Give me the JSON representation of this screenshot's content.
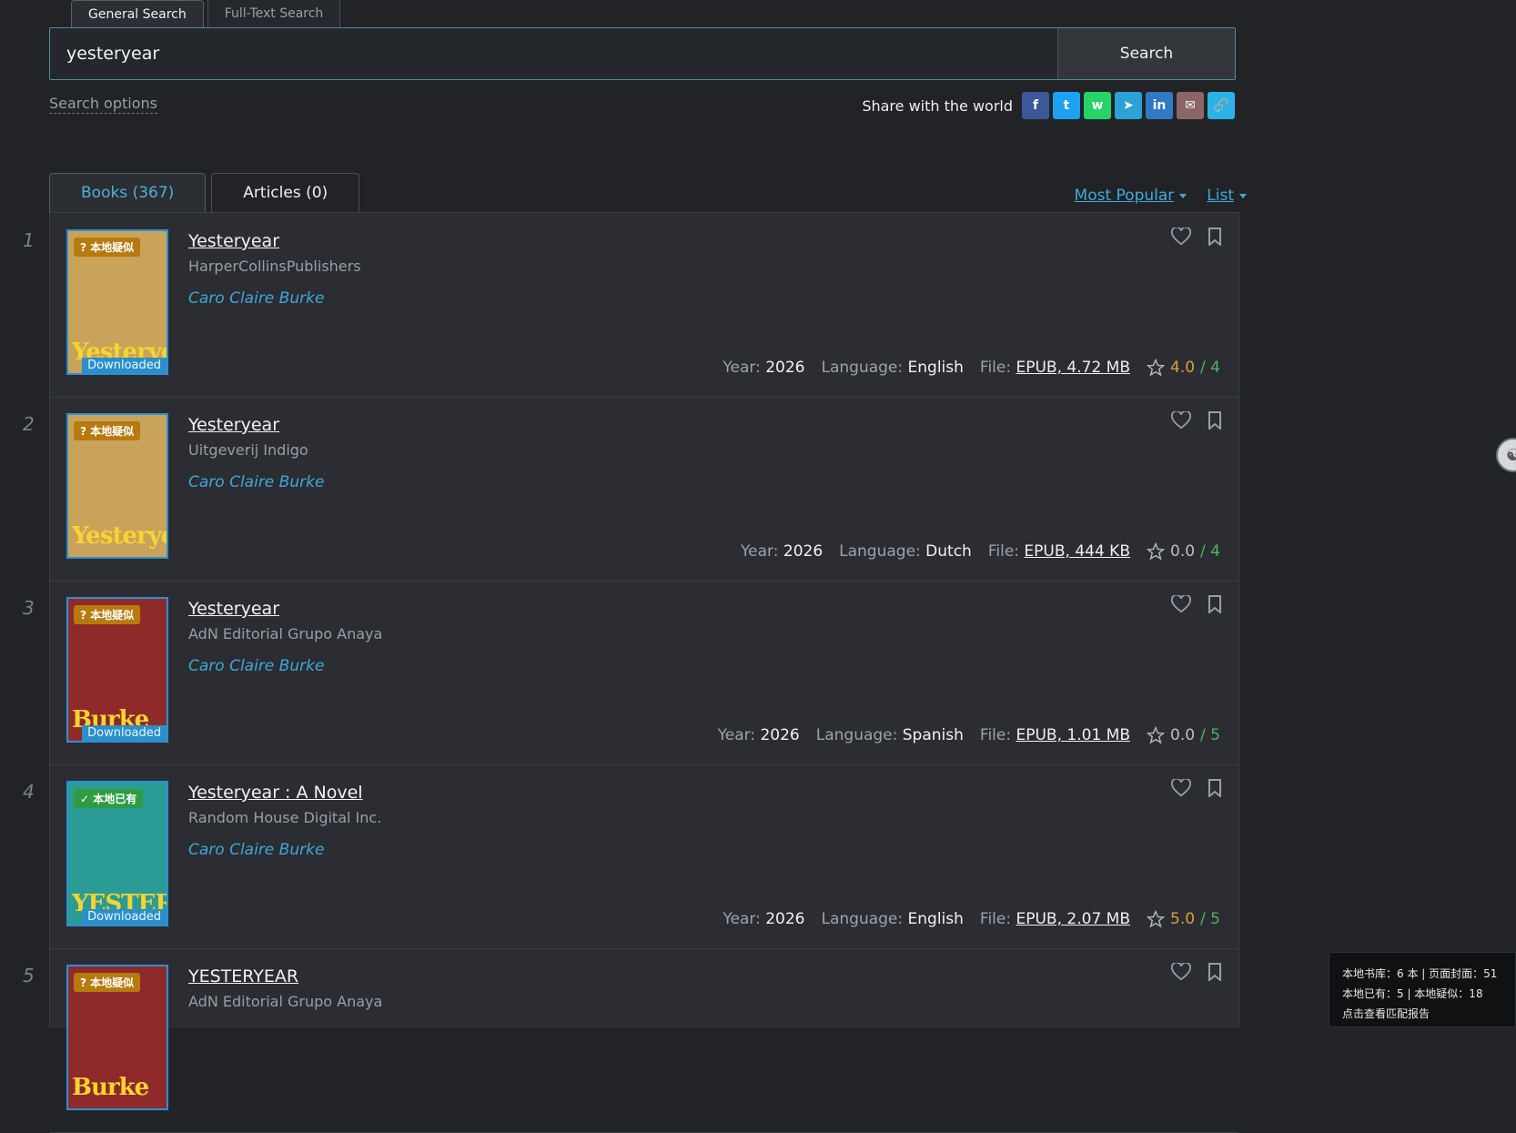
{
  "top_tabs": [
    {
      "label": "General Search",
      "active": true
    },
    {
      "label": "Full-Text Search",
      "active": false
    }
  ],
  "search": {
    "value": "yesteryear",
    "button_label": "Search"
  },
  "search_options_label": "Search options",
  "share": {
    "label": "Share with the world",
    "buttons": [
      {
        "icon": "facebook-icon",
        "glyph": "f",
        "color": "#3b5998"
      },
      {
        "icon": "twitter-icon",
        "glyph": "t",
        "color": "#1da1f2"
      },
      {
        "icon": "whatsapp-icon",
        "glyph": "w",
        "color": "#25d366"
      },
      {
        "icon": "telegram-icon",
        "glyph": "➤",
        "color": "#2aa2d6"
      },
      {
        "icon": "linkedin-icon",
        "glyph": "in",
        "color": "#2f7ac3"
      },
      {
        "icon": "email-icon",
        "glyph": "✉",
        "color": "#8c6666"
      },
      {
        "icon": "link-icon",
        "glyph": "🔗",
        "color": "#2ab3e8"
      }
    ]
  },
  "result_tabs": [
    {
      "label": "Books (367)",
      "active": true
    },
    {
      "label": "Articles  (0)",
      "active": false
    }
  ],
  "sort": {
    "order_label": "Most Popular",
    "view_label": "List"
  },
  "items": [
    {
      "index": "1",
      "title": "Yesteryear",
      "publisher": "HarperCollinsPublishers",
      "author": "Caro Claire Burke",
      "tag": "? 本地疑似",
      "tag_type": "suspect",
      "downloaded": "Downloaded",
      "year": "2026",
      "language": "English",
      "file": "EPUB, 4.72 MB",
      "rating": "4.0",
      "rating_total": "/ 4",
      "cover_text": "Yesteryear",
      "cover_bg": "#c9a35a"
    },
    {
      "index": "2",
      "title": "Yesteryear",
      "publisher": "Uitgeverij Indigo",
      "author": "Caro Claire Burke",
      "tag": "? 本地疑似",
      "tag_type": "suspect",
      "downloaded": "",
      "year": "2026",
      "language": "Dutch",
      "file": "EPUB, 444 KB",
      "rating": "0.0",
      "rating_total": "/ 4",
      "cover_text": "Yesteryear",
      "cover_bg": "#c9a35a"
    },
    {
      "index": "3",
      "title": "Yesteryear",
      "publisher": "AdN Editorial Grupo Anaya",
      "author": "Caro Claire Burke",
      "tag": "? 本地疑似",
      "tag_type": "suspect",
      "downloaded": "Downloaded",
      "year": "2026",
      "language": "Spanish",
      "file": "EPUB, 1.01 MB",
      "rating": "0.0",
      "rating_total": "/ 5",
      "cover_text": "Burke",
      "cover_bg": "#8f2a2a"
    },
    {
      "index": "4",
      "title": "Yesteryear : A Novel",
      "publisher": "Random House Digital Inc.",
      "author": "Caro Claire Burke",
      "tag": "✓ 本地已有",
      "tag_type": "have",
      "downloaded": "Downloaded",
      "year": "2026",
      "language": "English",
      "file": "EPUB, 2.07 MB",
      "rating": "5.0",
      "rating_total": "/ 5",
      "cover_text": "YESTERYEAR",
      "cover_bg": "#2b9b95"
    },
    {
      "index": "5",
      "title": "YESTERYEAR",
      "publisher": "AdN Editorial Grupo Anaya",
      "author": "",
      "tag": "? 本地疑似",
      "tag_type": "suspect",
      "downloaded": "",
      "year": "",
      "language": "",
      "file": "",
      "rating": "",
      "rating_total": "",
      "cover_text": "Burke",
      "cover_bg": "#8f2a2a"
    }
  ],
  "meta_labels": {
    "year": "Year:",
    "language": "Language:",
    "file": "File:"
  },
  "local_panel": {
    "line1": "本地书库：6 本 | 页面封面：51",
    "line2": "本地已有：5 | 本地疑似：18",
    "line3": "点击查看匹配报告"
  }
}
